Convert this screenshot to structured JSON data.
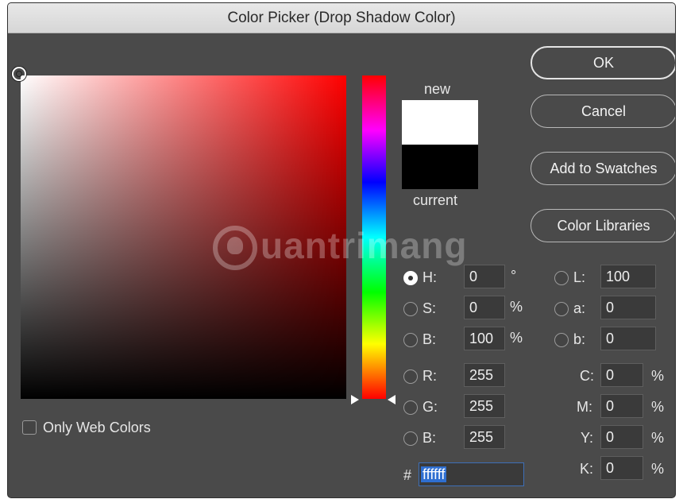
{
  "window": {
    "title": "Color Picker (Drop Shadow Color)"
  },
  "swatch": {
    "new_label": "new",
    "current_label": "current",
    "new_color": "#ffffff",
    "current_color": "#000000"
  },
  "buttons": {
    "ok": "OK",
    "cancel": "Cancel",
    "add_to_swatches": "Add to Swatches",
    "color_libraries": "Color Libraries"
  },
  "options": {
    "only_web_colors": "Only Web Colors"
  },
  "hsb": {
    "h": {
      "label": "H:",
      "value": "0",
      "unit": "°"
    },
    "s": {
      "label": "S:",
      "value": "0",
      "unit": "%"
    },
    "b": {
      "label": "B:",
      "value": "100",
      "unit": "%"
    }
  },
  "rgb": {
    "r": {
      "label": "R:",
      "value": "255"
    },
    "g": {
      "label": "G:",
      "value": "255"
    },
    "b": {
      "label": "B:",
      "value": "255"
    }
  },
  "lab": {
    "l": {
      "label": "L:",
      "value": "100"
    },
    "a": {
      "label": "a:",
      "value": "0"
    },
    "b": {
      "label": "b:",
      "value": "0"
    }
  },
  "cmyk": {
    "c": {
      "label": "C:",
      "value": "0",
      "unit": "%"
    },
    "m": {
      "label": "M:",
      "value": "0",
      "unit": "%"
    },
    "y": {
      "label": "Y:",
      "value": "0",
      "unit": "%"
    },
    "k": {
      "label": "K:",
      "value": "0",
      "unit": "%"
    }
  },
  "hex": {
    "label": "#",
    "value": "ffffff"
  },
  "watermark": {
    "text": "uantrimang"
  },
  "colors": {
    "hue_selected": "#ff0000",
    "dialog_bg": "#4a4a4a",
    "selection": "#2f6fd1"
  }
}
